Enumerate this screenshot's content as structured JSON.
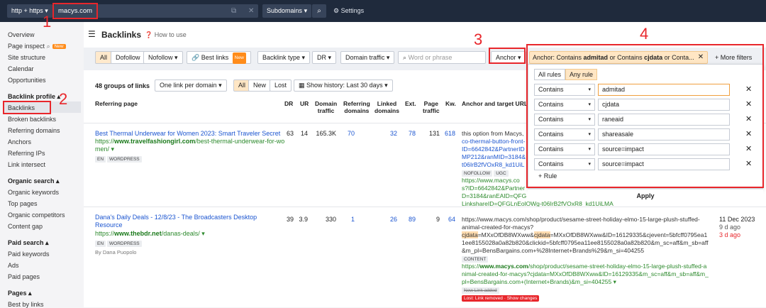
{
  "topbar": {
    "protocol": "http + https",
    "url": "macys.com",
    "mode": "Subdomains",
    "settings": "Settings"
  },
  "annotations": [
    "1",
    "2",
    "3",
    "4"
  ],
  "sidebar": {
    "items_top": [
      "Overview",
      "Page inspect",
      "Site structure",
      "Calendar",
      "Opportunities"
    ],
    "new_badge": "New",
    "backlink_profile": "Backlink profile",
    "backlink_items": [
      "Backlinks",
      "Broken backlinks",
      "Referring domains",
      "Anchors",
      "Referring IPs",
      "Link intersect"
    ],
    "organic_search": "Organic search",
    "organic_items": [
      "Organic keywords",
      "Top pages",
      "Organic competitors",
      "Content gap"
    ],
    "paid_search": "Paid search",
    "paid_items": [
      "Paid keywords",
      "Ads",
      "Paid pages"
    ],
    "pages": "Pages",
    "pages_items": [
      "Best by links"
    ]
  },
  "main": {
    "title": "Backlinks",
    "howto": "How to use",
    "filters": {
      "all": "All",
      "dofollow": "Dofollow",
      "nofollow": "Nofollow",
      "best_links": "Best links",
      "new_badge": "New",
      "link_type": "Backlink type",
      "dr": "DR",
      "domain_traffic": "Domain traffic",
      "search_placeholder": "Word or phrase",
      "anchor": "Anchor",
      "chip_prefix": "Anchor: Contains ",
      "chip_kw1": "admitad",
      "chip_or1": " or Contains ",
      "chip_kw2": "cjdata",
      "chip_rest": " or Conta...",
      "more_filters": "More filters"
    },
    "toolbar": {
      "groups": "48 groups of links",
      "per_domain": "One link per domain",
      "all": "All",
      "new": "New",
      "lost": "Lost",
      "history": "Show history: Last 30 days"
    },
    "headers": {
      "referring_page": "Referring page",
      "dr": "DR",
      "ur": "UR",
      "domain_traffic_1": "Domain",
      "domain_traffic_2": "traffic",
      "referring_domains_1": "Referring",
      "referring_domains_2": "domains",
      "linked_domains_1": "Linked",
      "linked_domains_2": "domains",
      "ext": "Ext.",
      "page_traffic_1": "Page",
      "page_traffic_2": "traffic",
      "kw": "Kw.",
      "anchor_target": "Anchor and target URL"
    },
    "rows": [
      {
        "title": "Best Thermal Underwear for Women 2023: Smart Traveler Secret",
        "url_prefix": "https://",
        "url_domain": "www.travelfashiongirl.com",
        "url_path": "/best-thermal-underwear-for-wo",
        "url_path2": "men/",
        "tags": [
          "EN",
          "WORDPRESS"
        ],
        "dr": "63",
        "ur": "14",
        "traffic": "165.3K",
        "ref_domains": "70",
        "linked_domains": "32",
        "ext": "78",
        "page_traffic": "131",
        "kw": "618",
        "anchor_lines": [
          "this option from Macys,",
          "co-thermal-button-front-",
          "ID=6642842&PartnerID",
          "MP212&ranMID=3184&",
          "t06IrB2fVOxR8_kd1UiL"
        ],
        "anchor_tags": [
          "NOFOLLOW",
          "UGC"
        ],
        "anchor_url_lines": [
          "https://www.macys.co",
          "s?ID=6642842&Partner",
          "D=3184&ranEAID=QFG",
          "LinkshareID=QFGLnEolOWg-t06IrB2fVOxR8_kd1UiLMA"
        ]
      },
      {
        "title": "Dana's Daily Deals - 12/8/23 - The Broadcasters Desktop",
        "title2": "Resource",
        "url_prefix": "https://",
        "url_domain": "www.thebdr.net",
        "url_path": "/danas-deals/",
        "tags": [
          "EN",
          "WORDPRESS"
        ],
        "author": "By Dana Puopolo",
        "dr": "39",
        "ur": "3.9",
        "traffic": "330",
        "ref_domains": "1",
        "linked_domains": "26",
        "ext": "89",
        "page_traffic": "9",
        "kw": "64",
        "anchor_line1": "https://www.macys.com/shop/product/sesame-street-holiday-elmo-15-large-plush-stuffed-",
        "anchor_line2a": "animal-created-for-macys?",
        "anchor_hl1": "cjdata",
        "anchor_line3a": "=MXxOfDB8WXww&",
        "anchor_hl2": "cjdata",
        "anchor_line3b": "=MXxOfDB8WXww&ID=16129335&cjevent=5bfcff0795ea1",
        "anchor_line4": "1ee8155028a0a82b820&clickid=5bfcff0795ea11ee8155028a0a82b820&m_sc=aff&m_sb=aff",
        "anchor_line5": "&m_pl=BensBargains.com+%28Internet+Brands%29&m_si=404255",
        "content_tag": "CONTENT",
        "target_prefix": "https://",
        "target_domain": "www.macys.com",
        "target_rest": "/shop/product/sesame-street-holiday-elmo-15-large-plush-stuffed-a",
        "target_line2": "nimal-created-for-macys?cjdata=MXxOfDB8WXww&ID=16129335&m_sc=aff&m_sb=aff&m_",
        "target_line3": "pl=BensBargains.com+(Internet+Brands)&m_si=404255",
        "new_link_tag": "New Link added",
        "lost_tag": "Lost: Link removed",
        "show_changes": "Show changes",
        "date": "11 Dec 2023",
        "ago1": "9 d ago",
        "ago2": "3 d ago"
      }
    ]
  },
  "popup": {
    "tab_all": "All rules",
    "tab_any": "Any rule",
    "rules": [
      {
        "op": "Contains",
        "value": "admitad"
      },
      {
        "op": "Contains",
        "value": "cjdata"
      },
      {
        "op": "Contains",
        "value": "raneaid"
      },
      {
        "op": "Contains",
        "value": "shareasale"
      },
      {
        "op": "Contains",
        "value": "source=impact"
      },
      {
        "op": "Contains",
        "value": "source=impact"
      }
    ],
    "add_rule": "Rule",
    "apply": "Apply"
  },
  "colors": {
    "topbar": "#1f2a3c",
    "accent_red": "#e8262b",
    "link_blue": "#1b55d0",
    "url_green": "#2d8a2d",
    "chip_orange": "#ffe6c4"
  }
}
